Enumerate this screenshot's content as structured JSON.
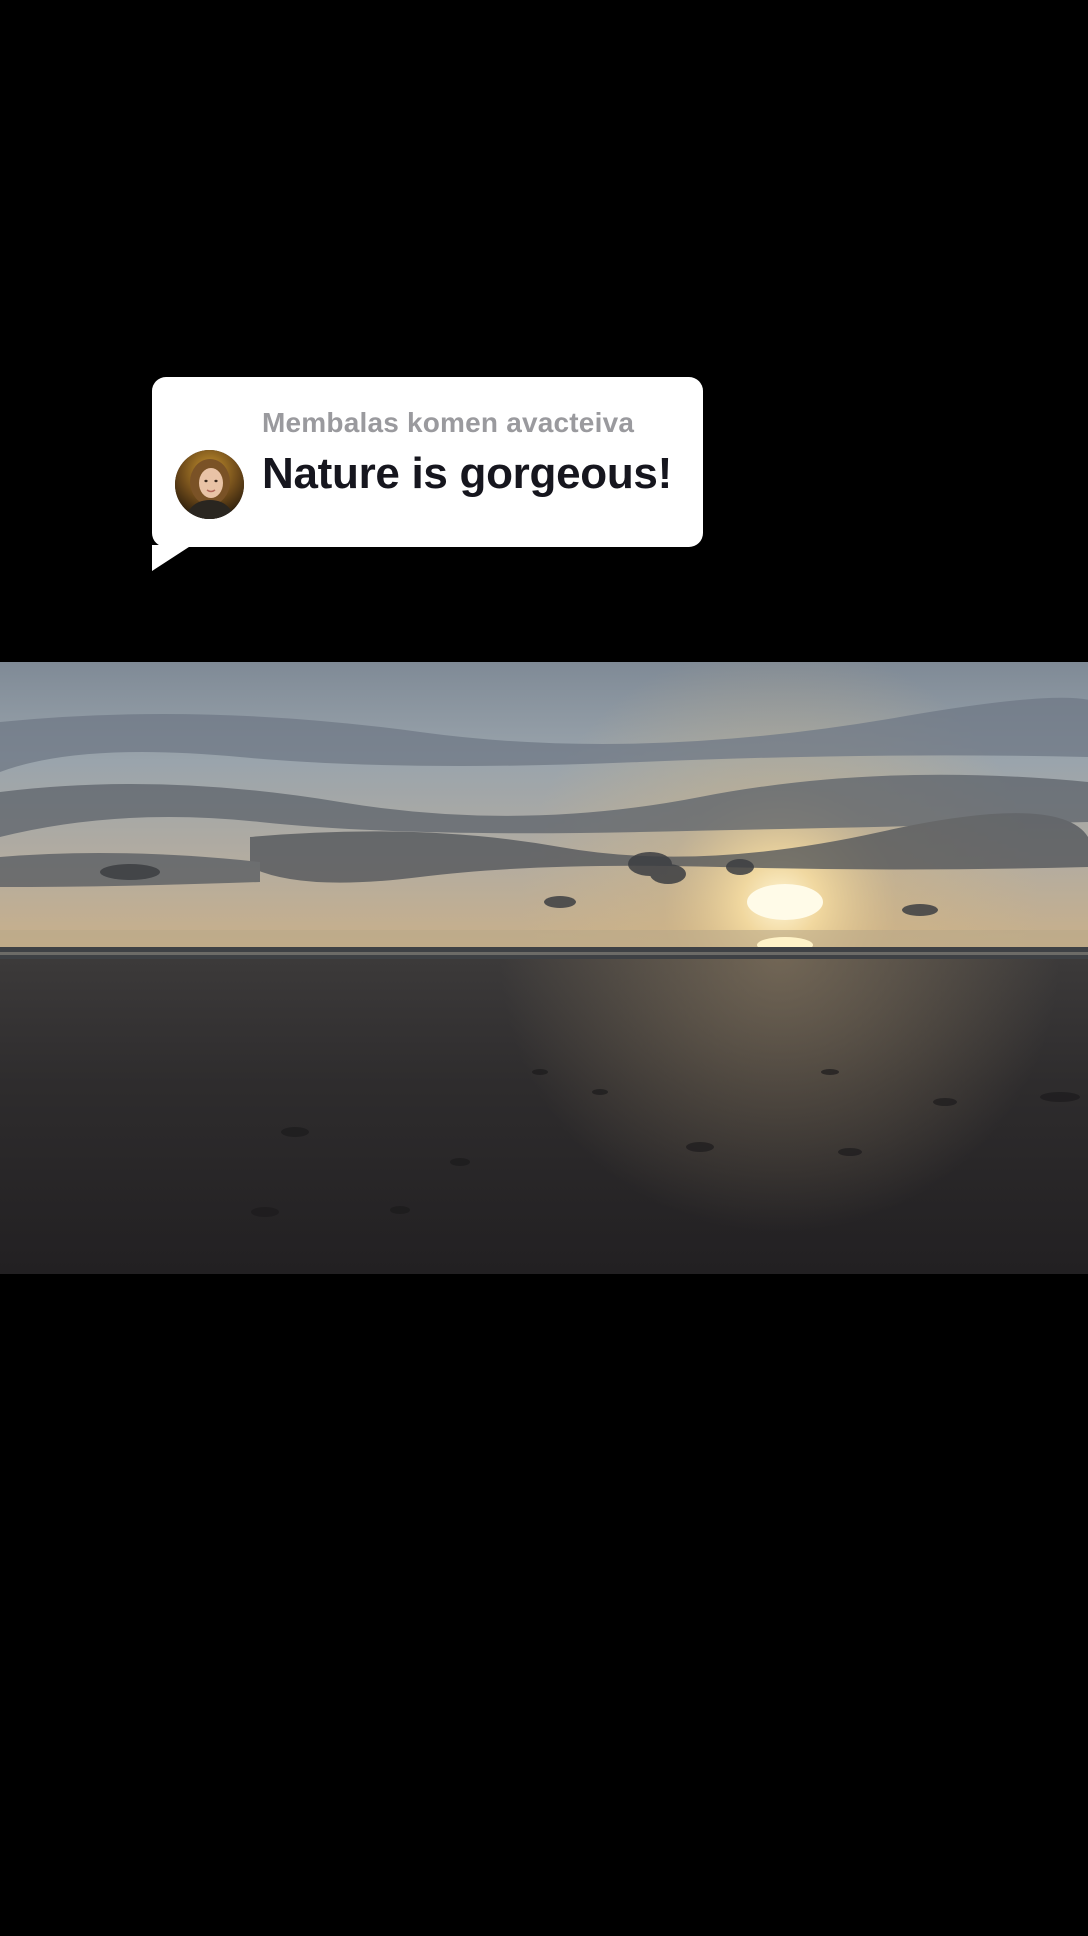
{
  "comment_sticker": {
    "header": "Membalas komen avacteiva",
    "comment": "Nature is gorgeous!",
    "avatar_icon": "user-avatar-photo"
  },
  "video": {
    "scene": "beach-sunset-video-frame"
  }
}
